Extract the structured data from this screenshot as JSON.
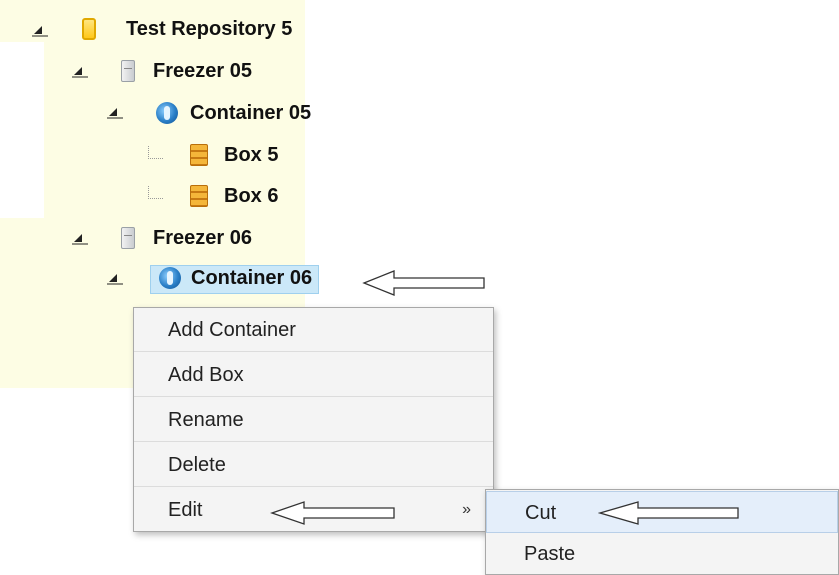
{
  "tree": {
    "repository": {
      "label": "Test Repository 5",
      "icon": "repository-icon"
    },
    "freezer_05": {
      "label": "Freezer 05",
      "icon": "freezer-icon"
    },
    "container_05": {
      "label": "Container 05",
      "icon": "container-icon"
    },
    "box_5": {
      "label": "Box 5",
      "icon": "box-icon"
    },
    "box_6": {
      "label": "Box 6",
      "icon": "box-icon"
    },
    "freezer_06": {
      "label": "Freezer 06",
      "icon": "freezer-icon"
    },
    "container_06": {
      "label": "Container 06",
      "icon": "container-icon",
      "selected": true
    }
  },
  "context_menu": {
    "items": [
      {
        "label": "Add Container"
      },
      {
        "label": "Add Box"
      },
      {
        "label": "Rename"
      },
      {
        "label": "Delete"
      },
      {
        "label": "Edit",
        "submenu_indicator": "»"
      }
    ]
  },
  "submenu": {
    "items": [
      {
        "label": "Cut",
        "highlighted": true
      },
      {
        "label": "Paste"
      }
    ]
  },
  "colors": {
    "tree_background": "#fdfde4",
    "selection": "#cbe8f8",
    "menu_background": "#f4f4f4"
  }
}
